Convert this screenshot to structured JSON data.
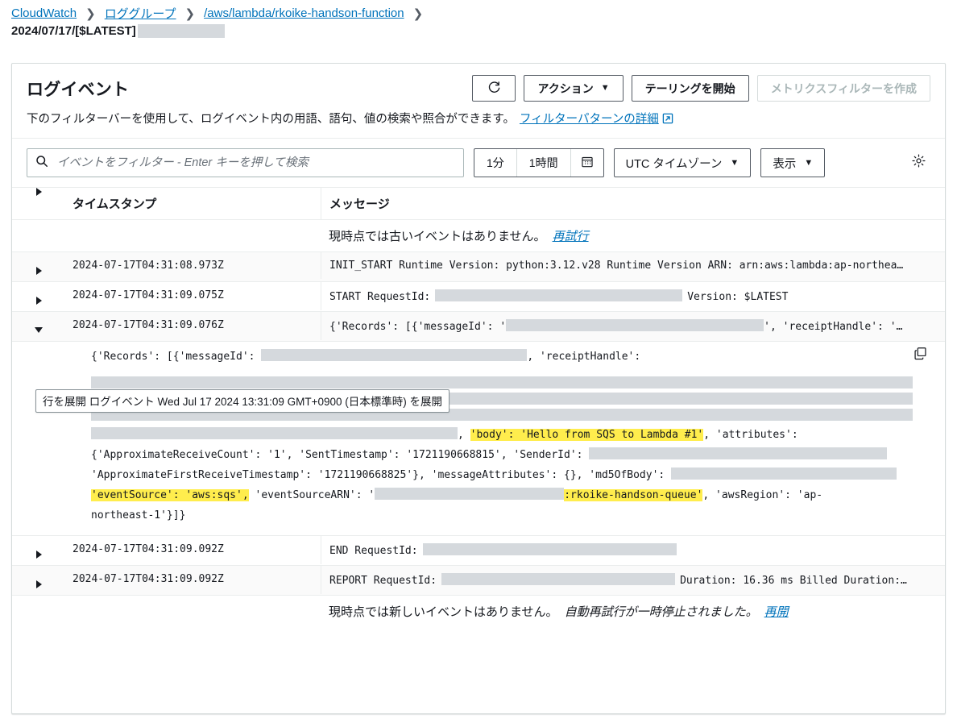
{
  "breadcrumb": {
    "items": [
      {
        "label": "CloudWatch",
        "type": "link"
      },
      {
        "label": "ロググループ",
        "type": "link"
      },
      {
        "label": "/aws/lambda/rkoike-handson-function",
        "type": "link"
      }
    ],
    "separator": "❯",
    "current": "2024/07/17/[$LATEST]"
  },
  "panel": {
    "title": "ログイベント",
    "refresh_icon": "refresh-icon",
    "actions_label": "アクション",
    "actions_caret": "▼",
    "tailing_label": "テーリングを開始",
    "metric_filter_label": "メトリクスフィルターを作成",
    "description": "下のフィルターバーを使用して、ログイベント内の用語、語句、値の検索や照合ができます。",
    "description_link": "フィルターパターンの詳細",
    "external_icon": "external-link-icon"
  },
  "filterbar": {
    "search_placeholder": "イベントをフィルター - Enter キーを押して検索",
    "search_value": "",
    "search_icon": "search-icon",
    "range_1m": "1分",
    "range_1h": "1時間",
    "calendar_icon": "calendar-icon",
    "timezone_label": "UTC タイムゾーン",
    "timezone_caret": "▼",
    "display_label": "表示",
    "display_caret": "▼",
    "settings_icon": "gear-icon"
  },
  "table": {
    "columns": {
      "timestamp": "タイムスタンプ",
      "message": "メッセージ"
    },
    "top_notice": {
      "text": "現時点では古いイベントはありません。",
      "link": "再試行"
    },
    "bottom_notice": {
      "text": "現時点では新しいイベントはありません。",
      "italic": "自動再試行が一時停止されました。",
      "link": "再開"
    },
    "rows": [
      {
        "timestamp": "2024-07-17T04:31:08.973Z",
        "message": "INIT_START Runtime Version: python:3.12.v28 Runtime Version ARN: arn:aws:lambda:ap-northea…",
        "expanded": false
      },
      {
        "timestamp": "2024-07-17T04:31:09.075Z",
        "message_pre": "START RequestId:",
        "message_post": "Version: $LATEST",
        "expanded": false
      },
      {
        "timestamp": "2024-07-17T04:31:09.076Z",
        "message_pre": "{'Records': [{'messageId': '",
        "message_mid": "', 'receiptHandle': '",
        "expanded": true
      },
      {
        "timestamp": "2024-07-17T04:31:09.092Z",
        "message_pre": "END RequestId:",
        "expanded": false
      },
      {
        "timestamp": "2024-07-17T04:31:09.092Z",
        "message_pre": "REPORT RequestId:",
        "message_post": "Duration: 16.36 ms Billed Duration:…",
        "expanded": false
      }
    ]
  },
  "tooltip": {
    "text": "行を展開 ログイベント Wed Jul 17 2024 13:31:09 GMT+0900 (日本標準時) を展開"
  },
  "detail": {
    "copy_icon": "copy-icon",
    "line1_a": "{'Records': [{'messageId': ",
    "line1_b": ", 'receiptHandle': ",
    "line5_a": ", ",
    "line5_hl": "'body': 'Hello from SQS to Lambda #1'",
    "line5_b": ", 'attributes': ",
    "line6_a": "{'ApproximateReceiveCount': '1', 'SentTimestamp': '1721190668815', 'SenderId': ",
    "line7_a": "'ApproximateFirstReceiveTimestamp': '1721190668825'}, 'messageAttributes': {}, 'md5OfBody': ",
    "line8_hl1": "'eventSource': 'aws:sqs',",
    "line8_a": " 'eventSourceARN': '",
    "line8_hl2": ":rkoike-handson-queue'",
    "line8_b": ", 'awsRegion': 'ap-",
    "line9_a": "northeast-1'}]}"
  },
  "colors": {
    "link": "#0073bb",
    "text": "#16191f",
    "highlight": "#ffed4d",
    "redacted": "#d5d9dd",
    "border": "#d5dbdb"
  }
}
